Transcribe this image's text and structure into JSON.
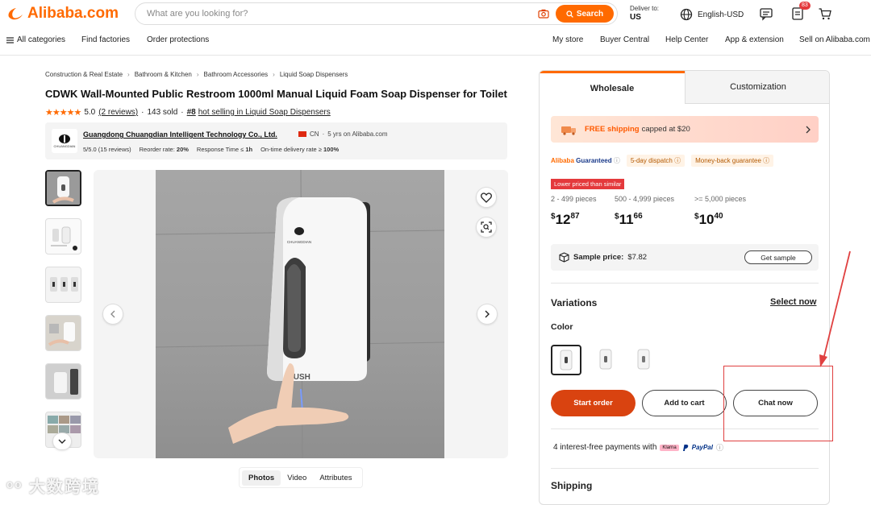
{
  "header": {
    "logo_text": "Alibaba.com",
    "search_placeholder": "What are you looking for?",
    "search_button": "Search",
    "deliver_label": "Deliver to:",
    "deliver_country": "US",
    "language_currency": "English-USD",
    "cart_badge": "83",
    "nav_left": [
      "All categories",
      "Find factories",
      "Order protections"
    ],
    "nav_right": [
      "My store",
      "Buyer Central",
      "Help Center",
      "App & extension",
      "Sell on Alibaba.com"
    ]
  },
  "product": {
    "breadcrumbs": [
      "Construction & Real Estate",
      "Bathroom & Kitchen",
      "Bathroom Accessories",
      "Liquid Soap Dispensers"
    ],
    "title": "CDWK Wall-Mounted Public Restroom 1000ml Manual Liquid Foam Soap Dispenser for Toilet",
    "rating": "5.0",
    "reviews": "(2 reviews)",
    "sold": "143 sold",
    "rank": "#8",
    "rank_text": "hot selling in Liquid Soap Dispensers",
    "media_tabs": [
      "Photos",
      "Video",
      "Attributes"
    ],
    "dispenser_label": "CHUANGDIAN",
    "push_label": "PUSH"
  },
  "supplier": {
    "name": "Guangdong Chuangdian Intelligent Technology Co., Ltd.",
    "country": "CN",
    "years": "5 yrs on Alibaba.com",
    "rating": "5/5.0",
    "rating_reviews": "(15 reviews)",
    "reorder_label": "Reorder rate:",
    "reorder_value": "20%",
    "response_label": "Response Time ≤",
    "response_value": "1h",
    "delivery_label": "On-time delivery rate ≥",
    "delivery_value": "100%",
    "logo_text": "CHUANGDIAN"
  },
  "panel": {
    "tabs": [
      "Wholesale",
      "Customization"
    ],
    "shipping_free": "FREE shipping",
    "shipping_rest": "capped at $20",
    "guarantee_brand": "Alibaba",
    "guarantee_word": "Guaranteed",
    "guarantee_tags": [
      "5-day dispatch",
      "Money-back guarantee"
    ],
    "lower_priced": "Lower priced than similar",
    "tiers": [
      {
        "range": "2 - 499 pieces",
        "dollars": "12",
        "cents": "87"
      },
      {
        "range": "500 - 4,999 pieces",
        "dollars": "11",
        "cents": "66"
      },
      {
        "range": ">= 5,000 pieces",
        "dollars": "10",
        "cents": "40"
      }
    ],
    "currency_symbol": "$",
    "sample_label": "Sample price:",
    "sample_value": "$7.82",
    "get_sample": "Get sample",
    "variations": "Variations",
    "select_now": "Select now",
    "color_label": "Color",
    "start_order": "Start order",
    "add_to_cart": "Add to cart",
    "chat_now": "Chat now",
    "payments_text": "4 interest-free payments with",
    "klarna": "Klarna",
    "paypal": "PayPal",
    "shipping_heading": "Shipping"
  },
  "watermark": "大数跨境",
  "colors": {
    "accent": "#ff6a00",
    "start_order_bg": "#d94310",
    "annotation": "#e04040"
  }
}
